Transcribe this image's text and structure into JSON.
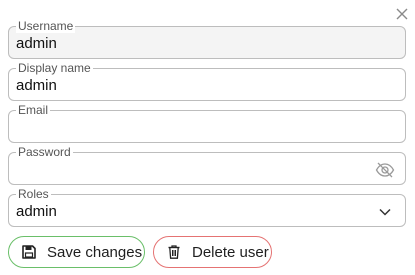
{
  "dialog": {
    "close_icon": "close-icon"
  },
  "fields": {
    "username": {
      "label": "Username",
      "value": "admin"
    },
    "display_name": {
      "label": "Display name",
      "value": "admin"
    },
    "email": {
      "label": "Email",
      "value": ""
    },
    "password": {
      "label": "Password",
      "value": "",
      "icon": "eye-off-icon"
    },
    "roles": {
      "label": "Roles",
      "value": "admin",
      "icon": "chevron-down-icon"
    }
  },
  "actions": {
    "save_label": "Save changes",
    "delete_label": "Delete user",
    "save_icon": "floppy-disk-icon",
    "delete_icon": "trash-icon"
  },
  "colors": {
    "save_border": "#6abf69",
    "delete_border": "#e57373",
    "field_border": "#bdbdbd"
  }
}
